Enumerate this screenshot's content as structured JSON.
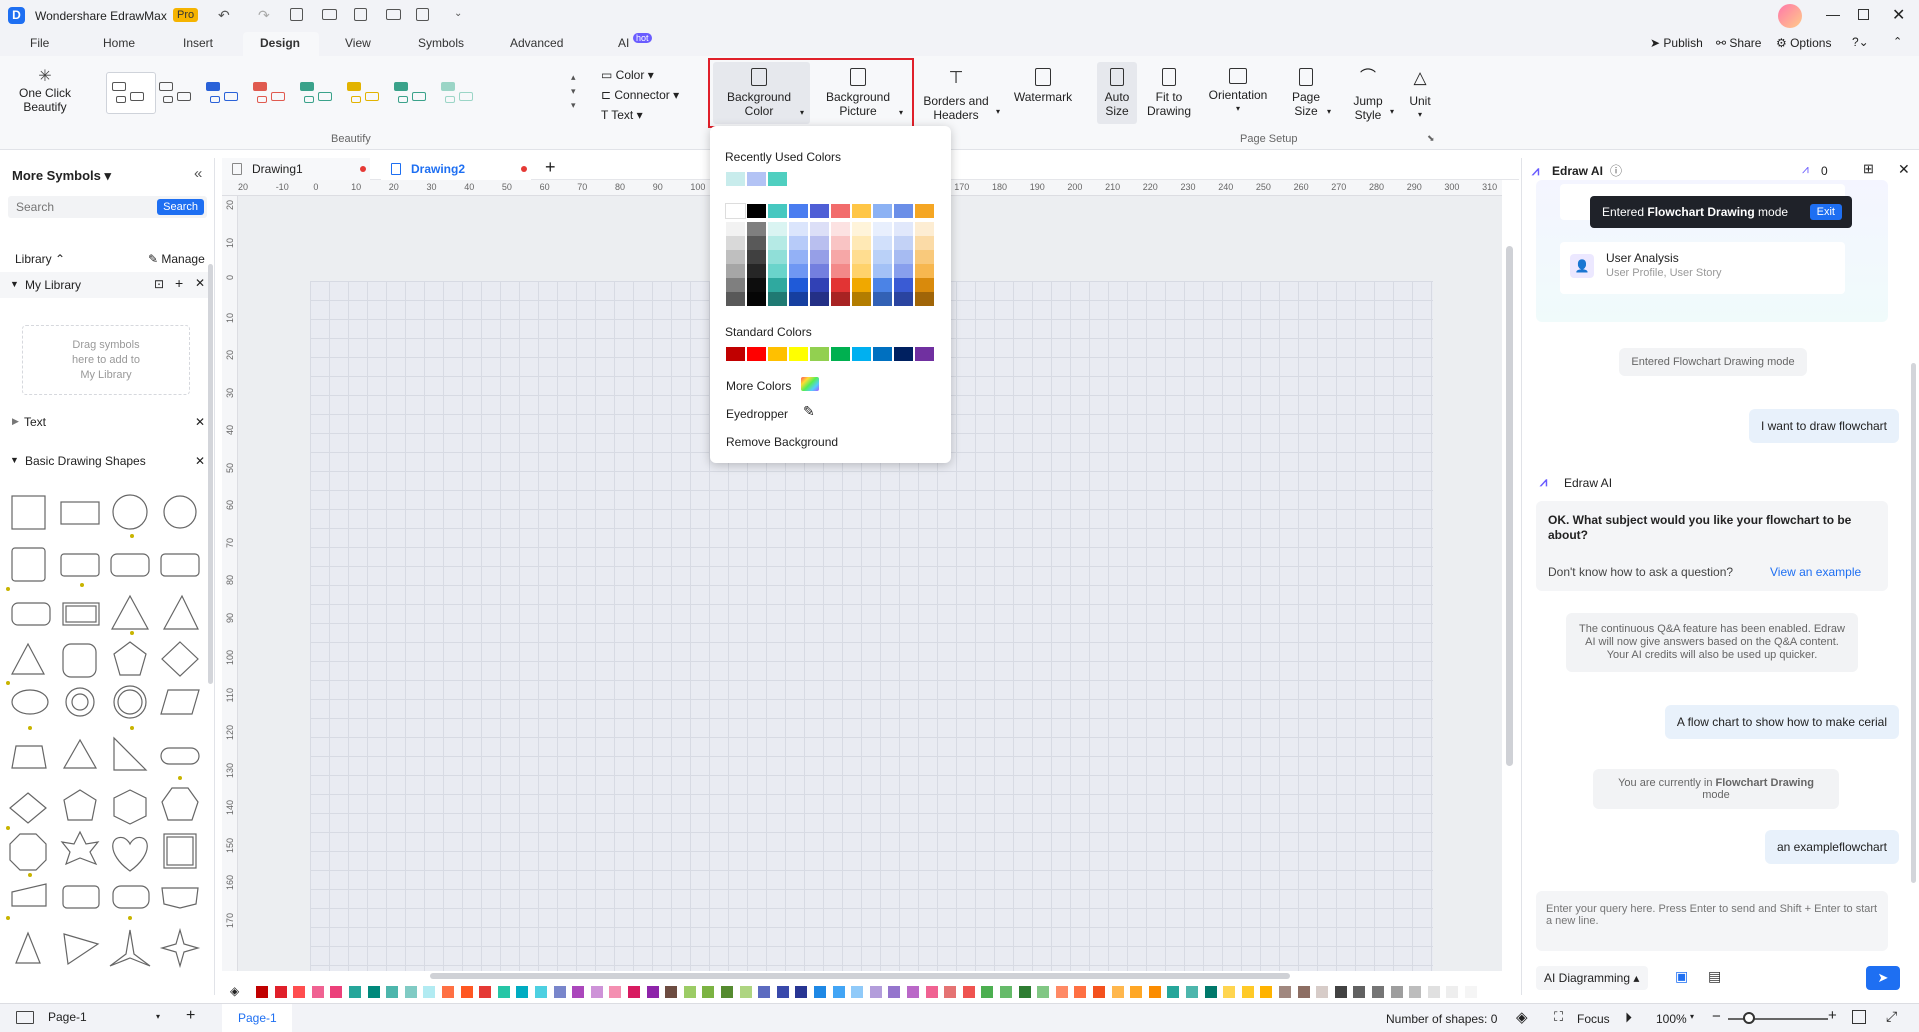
{
  "app": {
    "name": "Wondershare EdrawMax",
    "badge": "Pro",
    "publish": "Publish",
    "share": "Share",
    "options": "Options"
  },
  "menu": {
    "tabs": [
      "File",
      "Home",
      "Insert",
      "Design",
      "View",
      "Symbols",
      "Advanced",
      "AI"
    ],
    "ai_badge": "hot",
    "active": "Design"
  },
  "ribbon": {
    "one_click_beautify": "One Click\nBeautify",
    "beautify_group": "Beautify",
    "color": "Color",
    "connector": "Connector",
    "text": "Text",
    "background_color": "Background\nColor",
    "background_picture": "Background\nPicture",
    "borders_headers": "Borders and\nHeaders",
    "watermark": "Watermark",
    "auto_size": "Auto\nSize",
    "fit_to_drawing": "Fit to\nDrawing",
    "orientation": "Orientation",
    "page_size": "Page\nSize",
    "jump_style": "Jump\nStyle",
    "unit": "Unit",
    "page_setup_group": "Page Setup",
    "highlight_color": "#e0202a"
  },
  "left": {
    "title": "More Symbols",
    "search_placeholder": "Search",
    "search_btn": "Search",
    "library": "Library",
    "manage": "Manage",
    "my_library": "My Library",
    "drag_hint": "Drag symbols\nhere to add to\nMy Library",
    "text_section": "Text",
    "basic_shapes": "Basic Drawing Shapes"
  },
  "docs": {
    "tabs": [
      "Drawing1",
      "Drawing2"
    ],
    "active": "Drawing2"
  },
  "ruler": {
    "top": [
      "20",
      "-10",
      "0",
      "10",
      "20",
      "30",
      "40",
      "50",
      "60",
      "70",
      "80",
      "90",
      "100",
      "110",
      "120",
      "130",
      "140",
      "150",
      "160",
      "170",
      "180",
      "190",
      "200",
      "210",
      "220",
      "230",
      "240",
      "250",
      "260",
      "270",
      "280",
      "290",
      "300",
      "310"
    ],
    "left": [
      "20",
      "10",
      "0",
      "10",
      "20",
      "30",
      "40",
      "50",
      "60",
      "70",
      "80",
      "90",
      "100",
      "110",
      "120",
      "130",
      "140",
      "150",
      "160",
      "170"
    ]
  },
  "dropdown": {
    "recent_title": "Recently Used Colors",
    "recent": [
      "#c8ecec",
      "#b3c3f5",
      "#4fcfc0"
    ],
    "standard_title": "Standard Colors",
    "standard": [
      "#c00000",
      "#ff0000",
      "#ffc000",
      "#ffff00",
      "#92d050",
      "#00b050",
      "#00b0f0",
      "#0070c0",
      "#002060",
      "#7030a0"
    ],
    "more_colors": "More Colors",
    "eyedropper": "Eyedropper",
    "remove_bg": "Remove Background",
    "grid_top": [
      "#ffffff",
      "#000000",
      "#46c8c0",
      "#4a7df0",
      "#4f5fd6",
      "#f26c6c",
      "#ffc646",
      "#8cb2f4",
      "#6b8fe8",
      "#f5a623"
    ],
    "grid_cols": [
      [
        "#f2f2f2",
        "#d9d9d9",
        "#bfbfbf",
        "#a6a6a6",
        "#7f7f7f",
        "#595959"
      ],
      [
        "#7f7f7f",
        "#595959",
        "#404040",
        "#262626",
        "#0d0d0d",
        "#050505"
      ],
      [
        "#daf4f2",
        "#b5eae5",
        "#90dfd8",
        "#6ad4cb",
        "#2fa99f",
        "#1f7a73"
      ],
      [
        "#dbe5fc",
        "#b7cbf9",
        "#93b1f6",
        "#6f97f3",
        "#1f5ad8",
        "#163fa0"
      ],
      [
        "#dcdff7",
        "#b9bfef",
        "#969fe7",
        "#737fdf",
        "#3141b5",
        "#243086"
      ],
      [
        "#fce2e2",
        "#f9c4c4",
        "#f6a7a7",
        "#f38989",
        "#e23434",
        "#a82323"
      ],
      [
        "#fff4da",
        "#ffe9b5",
        "#ffdd90",
        "#ffd26b",
        "#f0a800",
        "#b37d00"
      ],
      [
        "#e8effd",
        "#d1e0fb",
        "#bad1f8",
        "#a3c1f6",
        "#4b83e6",
        "#3261b5"
      ],
      [
        "#e1e8fb",
        "#c3d2f6",
        "#a6bbf2",
        "#889fed",
        "#3a5bd4",
        "#2a44a0"
      ],
      [
        "#fdedd3",
        "#fbdba7",
        "#f9c97b",
        "#f7b74f",
        "#d98a0c",
        "#a06508"
      ]
    ]
  },
  "ai": {
    "title": "Edraw AI",
    "credits": "0",
    "toast": "Entered Flowchart Drawing mode",
    "toast_bold": "Flowchart Drawing",
    "exit": "Exit",
    "card_title": "User Analysis",
    "card_sub": "User Profile, User Story",
    "note1": "Entered Flowchart Drawing mode",
    "user1": "I want to draw flowchart",
    "bot_name": "Edraw AI",
    "bot_q": "OK. What subject would you like your flowchart to be about?",
    "bot_hint": "Don't know how to ask a question?",
    "bot_link": "View an example",
    "note2": "The continuous Q&A feature has been enabled. Edraw AI will now give answers based on the Q&A content. Your AI credits will also be used up quicker.",
    "user2": "A flow chart to show how to make cerial",
    "note3_pre": "You are currently in ",
    "note3_bold": "Flowchart Drawing",
    "note3_post": " mode",
    "user3": "an exampleflowchart",
    "input_placeholder": "Enter your query here. Press Enter to send and Shift + Enter to start a new line.",
    "mode": "AI Diagramming"
  },
  "status": {
    "page_select": "Page-1",
    "page_tab": "Page-1",
    "shapes": "Number of shapes: 0",
    "focus": "Focus",
    "zoom": "100%"
  },
  "palette": [
    "#c00000",
    "#e0202a",
    "#ff4d4f",
    "#f06292",
    "#ec407a",
    "#26a69a",
    "#00897b",
    "#4db6ac",
    "#80cbc4",
    "#b2ebf2",
    "#ff7043",
    "#ff5722",
    "#e53935",
    "#26c6a6",
    "#00acc1",
    "#4dd0e1",
    "#7986cb",
    "#ab47bc",
    "#ce93d8",
    "#f48fb1",
    "#d81b60",
    "#8e24aa",
    "#6d4c41",
    "#9ccc65",
    "#7cb342",
    "#558b2f",
    "#aed581",
    "#5c6bc0",
    "#3949ab",
    "#283593",
    "#1e88e5",
    "#42a5f5",
    "#90caf9",
    "#b39ddb",
    "#9575cd",
    "#ba68c8",
    "#f06292",
    "#e57373",
    "#ef5350",
    "#4caf50",
    "#66bb6a",
    "#2e7d32",
    "#81c784",
    "#ff8a65",
    "#ff7043",
    "#f4511e",
    "#ffb74d",
    "#ffa726",
    "#fb8c00",
    "#26a69a",
    "#4db6ac",
    "#00796b",
    "#ffd54f",
    "#ffca28",
    "#ffb300",
    "#a1887f",
    "#8d6e63",
    "#d7ccc8",
    "#424242",
    "#616161",
    "#757575",
    "#9e9e9e",
    "#bdbdbd",
    "#e0e0e0",
    "#eeeeee",
    "#f5f5f5"
  ]
}
